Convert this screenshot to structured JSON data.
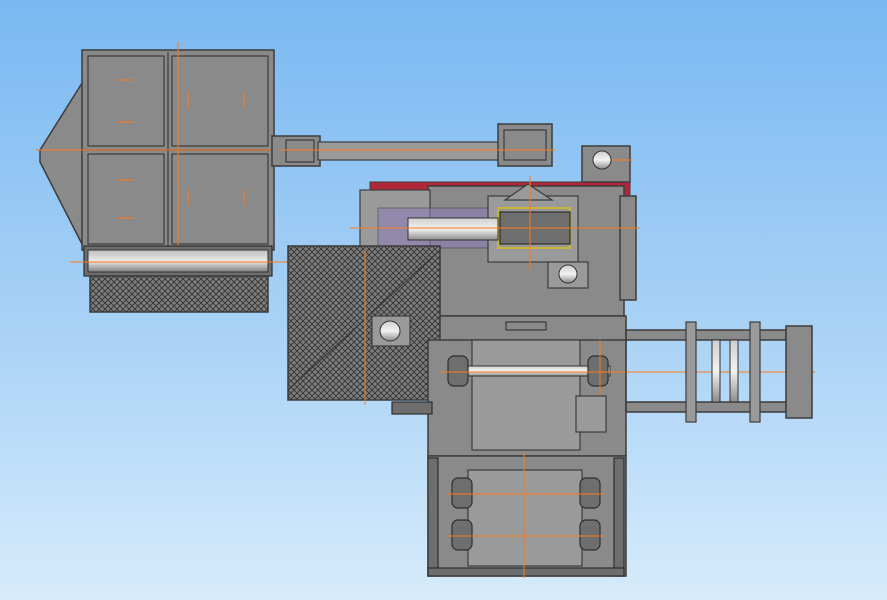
{
  "scene": {
    "kind": "cad-top-view",
    "background_colors": [
      "#7ab8f2",
      "#d6ebfb"
    ],
    "metal_color": "#8a8a8a",
    "axis_color": "#ff7a1a",
    "accent_colors": {
      "green_block": "#2e8b57",
      "red_block": "#b0283a",
      "purple_tint": "#8a7ab8",
      "yellow_frame": "#c8b437"
    }
  }
}
